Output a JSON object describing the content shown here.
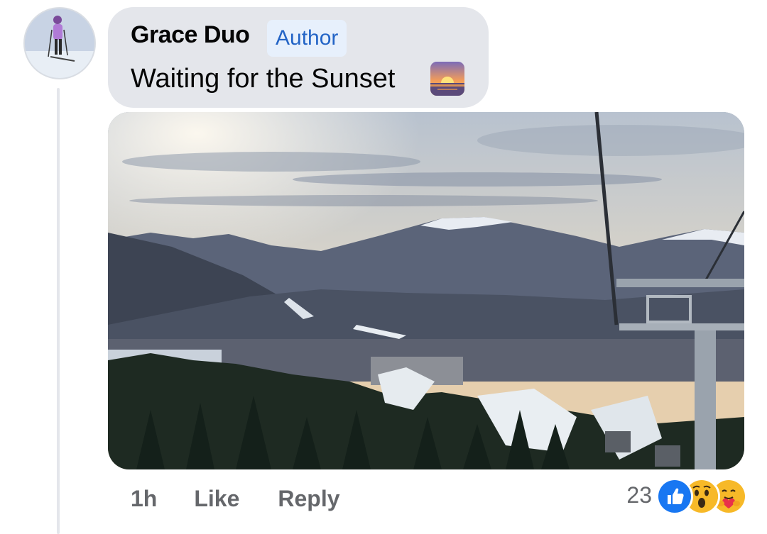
{
  "comment": {
    "author": "Grace Duo",
    "badge": "Author",
    "text": "Waiting for the Sunset",
    "emoji": "sunset-emoji"
  },
  "actions": {
    "timestamp": "1h",
    "like_label": "Like",
    "reply_label": "Reply"
  },
  "reactions": {
    "count": "23",
    "types": [
      "like",
      "wow",
      "care"
    ]
  },
  "colors": {
    "bubble": "#e4e6eb",
    "badge_bg": "#e7f0fc",
    "badge_text": "#2364c6",
    "meta_text": "#65676b",
    "like_blue": "#1877f2",
    "reaction_yellow": "#f7b928"
  }
}
